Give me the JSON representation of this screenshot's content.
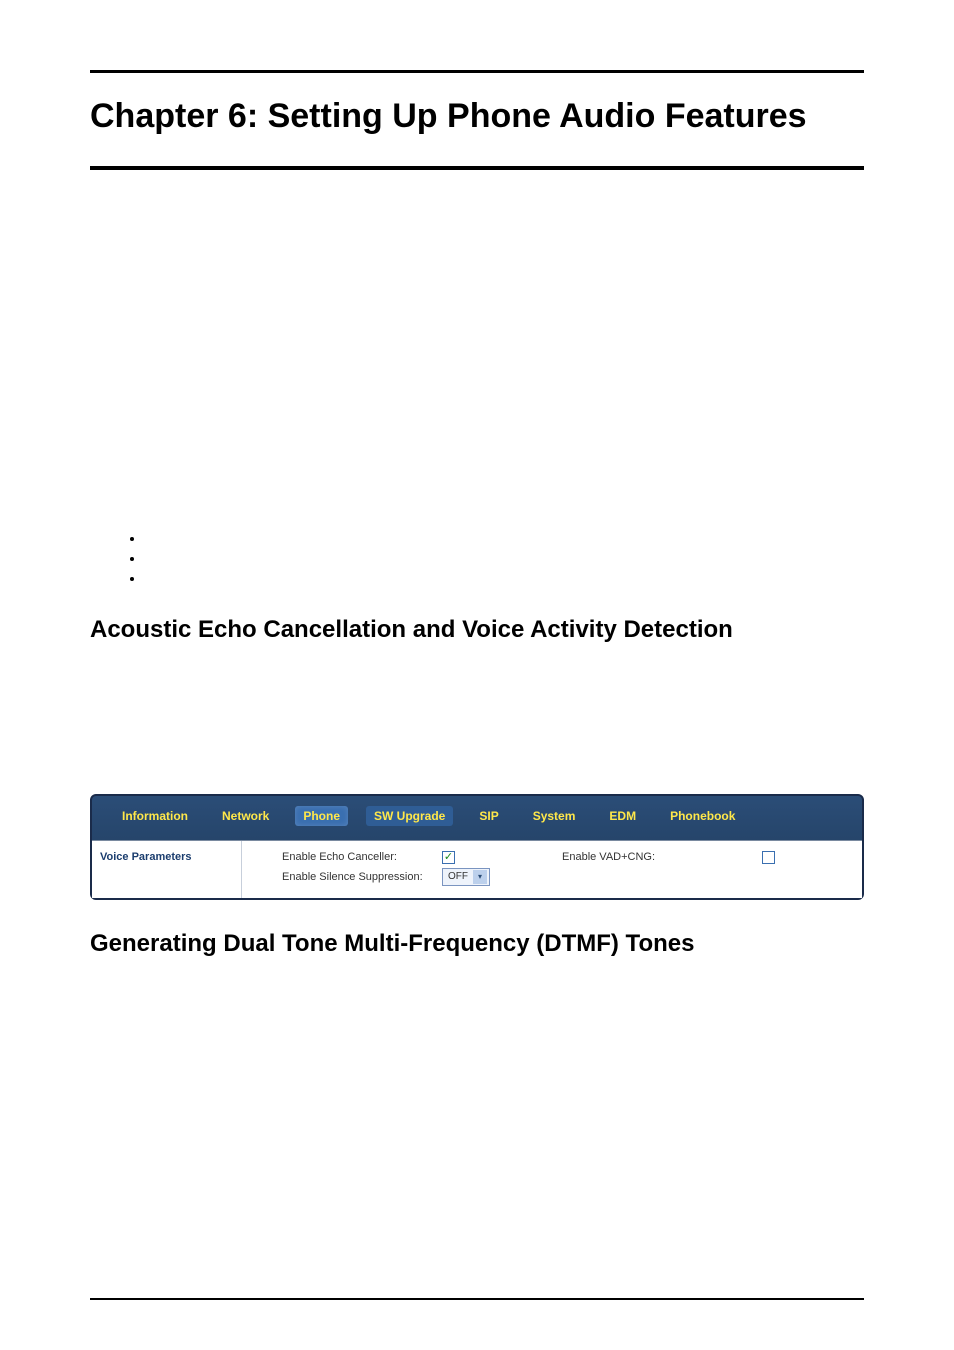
{
  "chapter_title": "Chapter 6: Setting Up Phone Audio Features",
  "bullets": [
    "",
    "",
    ""
  ],
  "section_aec_vad": "Acoustic Echo Cancellation and Voice Activity Detection",
  "section_dtmf": "Generating Dual Tone Multi-Frequency (DTMF) Tones",
  "ui": {
    "tabs": {
      "information": "Information",
      "network": "Network",
      "phone": "Phone",
      "sw_upgrade": "SW Upgrade",
      "sip": "SIP",
      "system": "System",
      "edm": "EDM",
      "phonebook": "Phonebook"
    },
    "side": "Voice Parameters",
    "form": {
      "echo_label": "Enable Echo Canceller:",
      "echo_checked": true,
      "vad_label": "Enable VAD+CNG:",
      "vad_checked": false,
      "silence_label": "Enable Silence Suppression:",
      "silence_value": "OFF"
    }
  }
}
